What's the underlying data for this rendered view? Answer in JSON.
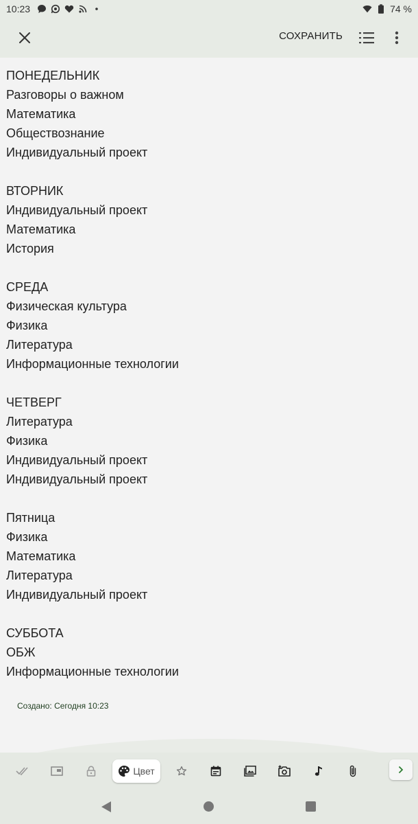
{
  "status_bar": {
    "time": "10:23",
    "battery_text": "74 %",
    "icons": [
      "message-icon",
      "whatsapp-icon",
      "heart-icon",
      "rss-icon",
      "dot-icon",
      "wifi-icon",
      "battery-icon"
    ]
  },
  "app_bar": {
    "save_label": "СОХРАНИТЬ",
    "icons": [
      "close-icon",
      "checklist-icon",
      "more-vert-icon"
    ]
  },
  "note": {
    "sections": [
      {
        "day": "ПОНЕДЕЛЬНИК",
        "lessons": [
          "Разговоры о важном",
          "Математика",
          "Обществознание",
          "Индивидуальный проект"
        ]
      },
      {
        "day": "ВТОРНИК",
        "lessons": [
          "Индивидуальный проект",
          "Математика",
          "История"
        ]
      },
      {
        "day": "СРЕДА",
        "lessons": [
          "Физическая культура",
          "Физика",
          "Литература",
          "Информационные технологии"
        ]
      },
      {
        "day": "ЧЕТВЕРГ",
        "lessons": [
          "Литература",
          "Физика",
          "Индивидуальный проект",
          "Индивидуальный проект"
        ]
      },
      {
        "day": "Пятница",
        "lessons": [
          "Физика",
          "Математика",
          "Литература",
          "Индивидуальный проект"
        ]
      },
      {
        "day": "СУББОТА",
        "lessons": [
          "ОБЖ",
          "Информационные технологии"
        ]
      }
    ]
  },
  "created_text": "Создано: Сегодня 10:23",
  "toolbar": {
    "color_label": "Цвет",
    "icons": [
      "double-check-icon",
      "card-icon",
      "lock-icon",
      "palette-icon",
      "star-icon",
      "calendar-icon",
      "image-icon",
      "camera-add-icon",
      "music-note-icon",
      "attachment-icon",
      "chevron-right-icon"
    ],
    "accent_color": "#2e7d32"
  },
  "nav_bar": {
    "icons": [
      "back-triangle-icon",
      "home-circle-icon",
      "recent-square-icon"
    ]
  }
}
